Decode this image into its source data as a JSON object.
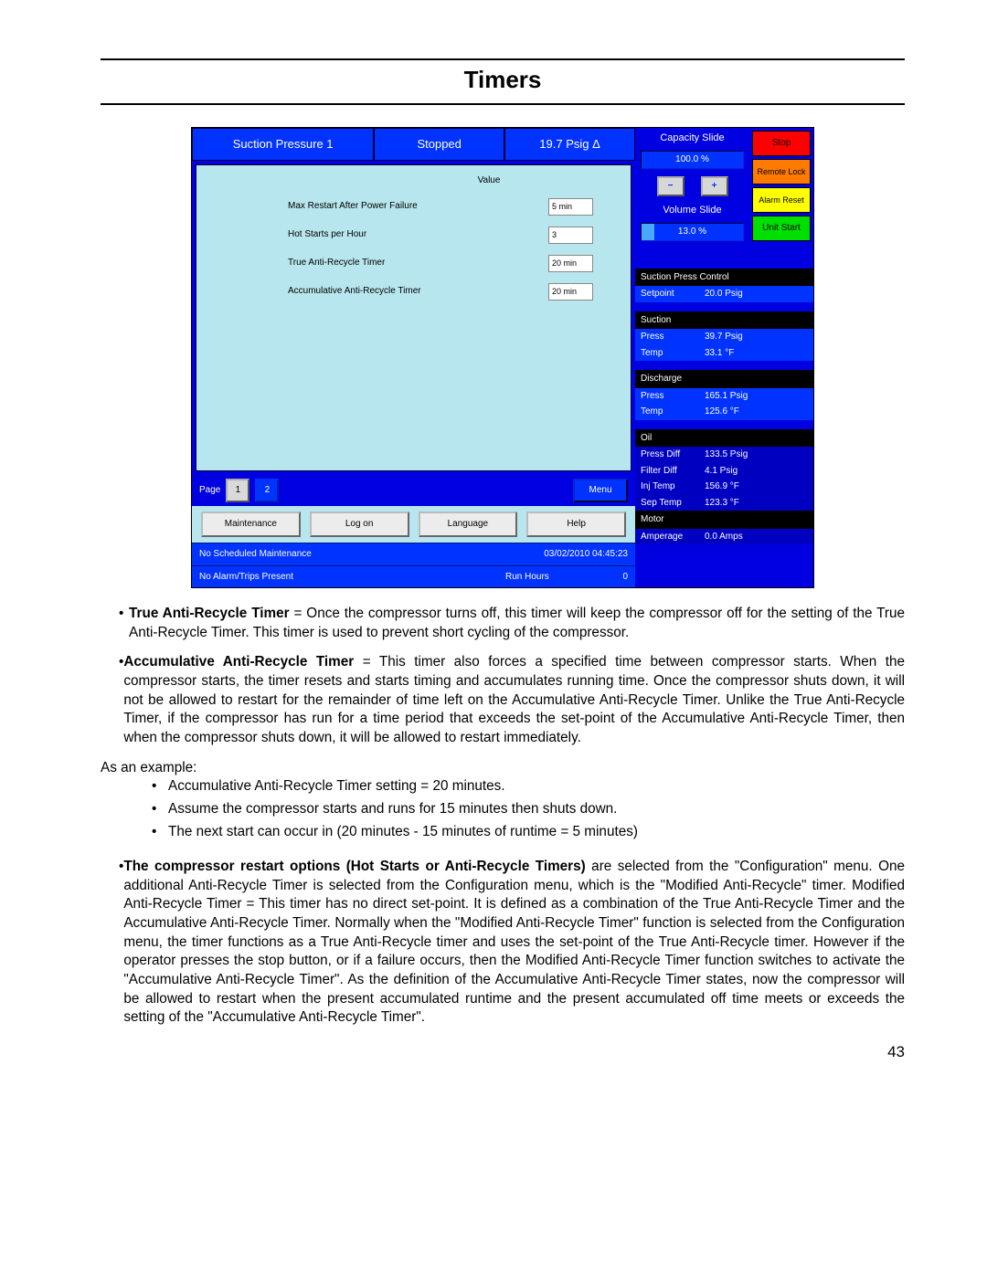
{
  "doc": {
    "title": "Timers",
    "page_number": "43"
  },
  "top": {
    "left": "Suction Pressure 1",
    "mid": "Stopped",
    "right": "19.7 Psig Δ"
  },
  "settings": {
    "value_header": "Value",
    "rows": [
      {
        "label": "Max Restart After Power Failure",
        "value": "5 min"
      },
      {
        "label": "Hot Starts per Hour",
        "value": "3"
      },
      {
        "label": "True Anti-Recycle Timer",
        "value": "20 min"
      },
      {
        "label": "Accumulative Anti-Recycle Timer",
        "value": "20 min"
      }
    ]
  },
  "page_nav": {
    "label": "Page",
    "p1": "1",
    "p2": "2",
    "menu": "Menu"
  },
  "btns": {
    "maintenance": "Maintenance",
    "logon": "Log on",
    "language": "Language",
    "help": "Help"
  },
  "status": {
    "maint": "No Scheduled Maintenance",
    "datetime": "03/02/2010  04:45:23",
    "alarm": "No Alarm/Trips Present",
    "runhours_lbl": "Run Hours",
    "runhours_val": "0"
  },
  "right": {
    "cap_slide_hdr": "Capacity Slide",
    "cap_slide_val": "100.0 %",
    "vol_slide_hdr": "Volume Slide",
    "vol_slide_val": "13.0 %",
    "btn_stop": "Stop",
    "btn_remote": "Remote Lock",
    "btn_alarm": "Alarm Reset",
    "btn_start": "Unit Start",
    "spc_hdr": "Suction Press Control",
    "spc_k": "Setpoint",
    "spc_v": "20.0 Psig",
    "suction_hdr": "Suction",
    "suction_press_k": "Press",
    "suction_press_v": "39.7 Psig",
    "suction_temp_k": "Temp",
    "suction_temp_v": "33.1 °F",
    "discharge_hdr": "Discharge",
    "discharge_press_k": "Press",
    "discharge_press_v": "165.1 Psig",
    "discharge_temp_k": "Temp",
    "discharge_temp_v": "125.6 °F",
    "oil_hdr": "Oil",
    "oil_pd_k": "Press Diff",
    "oil_pd_v": "133.5 Psig",
    "oil_fd_k": "Filter Diff",
    "oil_fd_v": "4.1 Psig",
    "oil_it_k": "Inj Temp",
    "oil_it_v": "156.9 °F",
    "oil_st_k": "Sep Temp",
    "oil_st_v": "123.3 °F",
    "motor_hdr": "Motor",
    "motor_k": "Amperage",
    "motor_v": "0.0 Amps"
  },
  "body": {
    "b1_bold": "True Anti-Recycle Timer",
    "b1_rest": " = Once the compressor turns off, this timer will keep the compressor off for the setting of the True Anti-Recycle Timer.  This timer is used to prevent short cycling of the compressor.",
    "b2_bold": "Accumulative Anti-Recycle Timer",
    "b2_rest": " = This timer also forces a specified time between compressor starts.  When the compressor starts, the timer resets and starts timing and accumulates running time.  Once the compressor shuts down, it will not be allowed to restart for the remainder of time left on the Accumulative Anti-Recycle Timer.  Unlike the True Anti-Recycle Timer, if the compressor has run for a time period that exceeds the set-point of the Accumulative Anti-Recycle Timer, then when the compressor shuts down, it will be allowed to restart immediately.",
    "example_intro": "As an example:",
    "ex1": "Accumulative Anti-Recycle Timer setting = 20 minutes.",
    "ex2": "Assume the compressor starts and runs for 15 minutes then shuts down.",
    "ex3": "The next start can occur in (20 minutes - 15 minutes of runtime = 5 minutes)",
    "b3_bold": "The compressor restart options (Hot Starts or Anti-Recycle Timers)",
    "b3_rest": " are selected from the \"Configuration\" menu.  One additional Anti-Recycle Timer is selected from the Configuration menu, which is the \"Modified Anti-Recycle\" timer. Modified Anti-Recycle Timer = This timer has no direct set-point.  It is defined as a combination of the True Anti-Recycle Timer and the Accumulative Anti-Recycle Timer.  Normally when the \"Modified Anti-Recycle Timer\" function is selected from the Configuration menu, the timer functions as a True Anti-Recycle timer and uses the set-point of the True Anti-Recycle timer. However if the operator presses the stop button, or if a failure occurs, then the Modified Anti-Recycle Timer function switches to activate the \"Accumulative Anti-Recycle Timer\". As the definition of the Accumulative Anti-Recycle Timer states, now the compressor will be allowed to restart when the present accumulated runtime and the present accumulated off time meets or exceeds the setting of the \"Accumulative Anti-Recycle Timer\"."
  }
}
